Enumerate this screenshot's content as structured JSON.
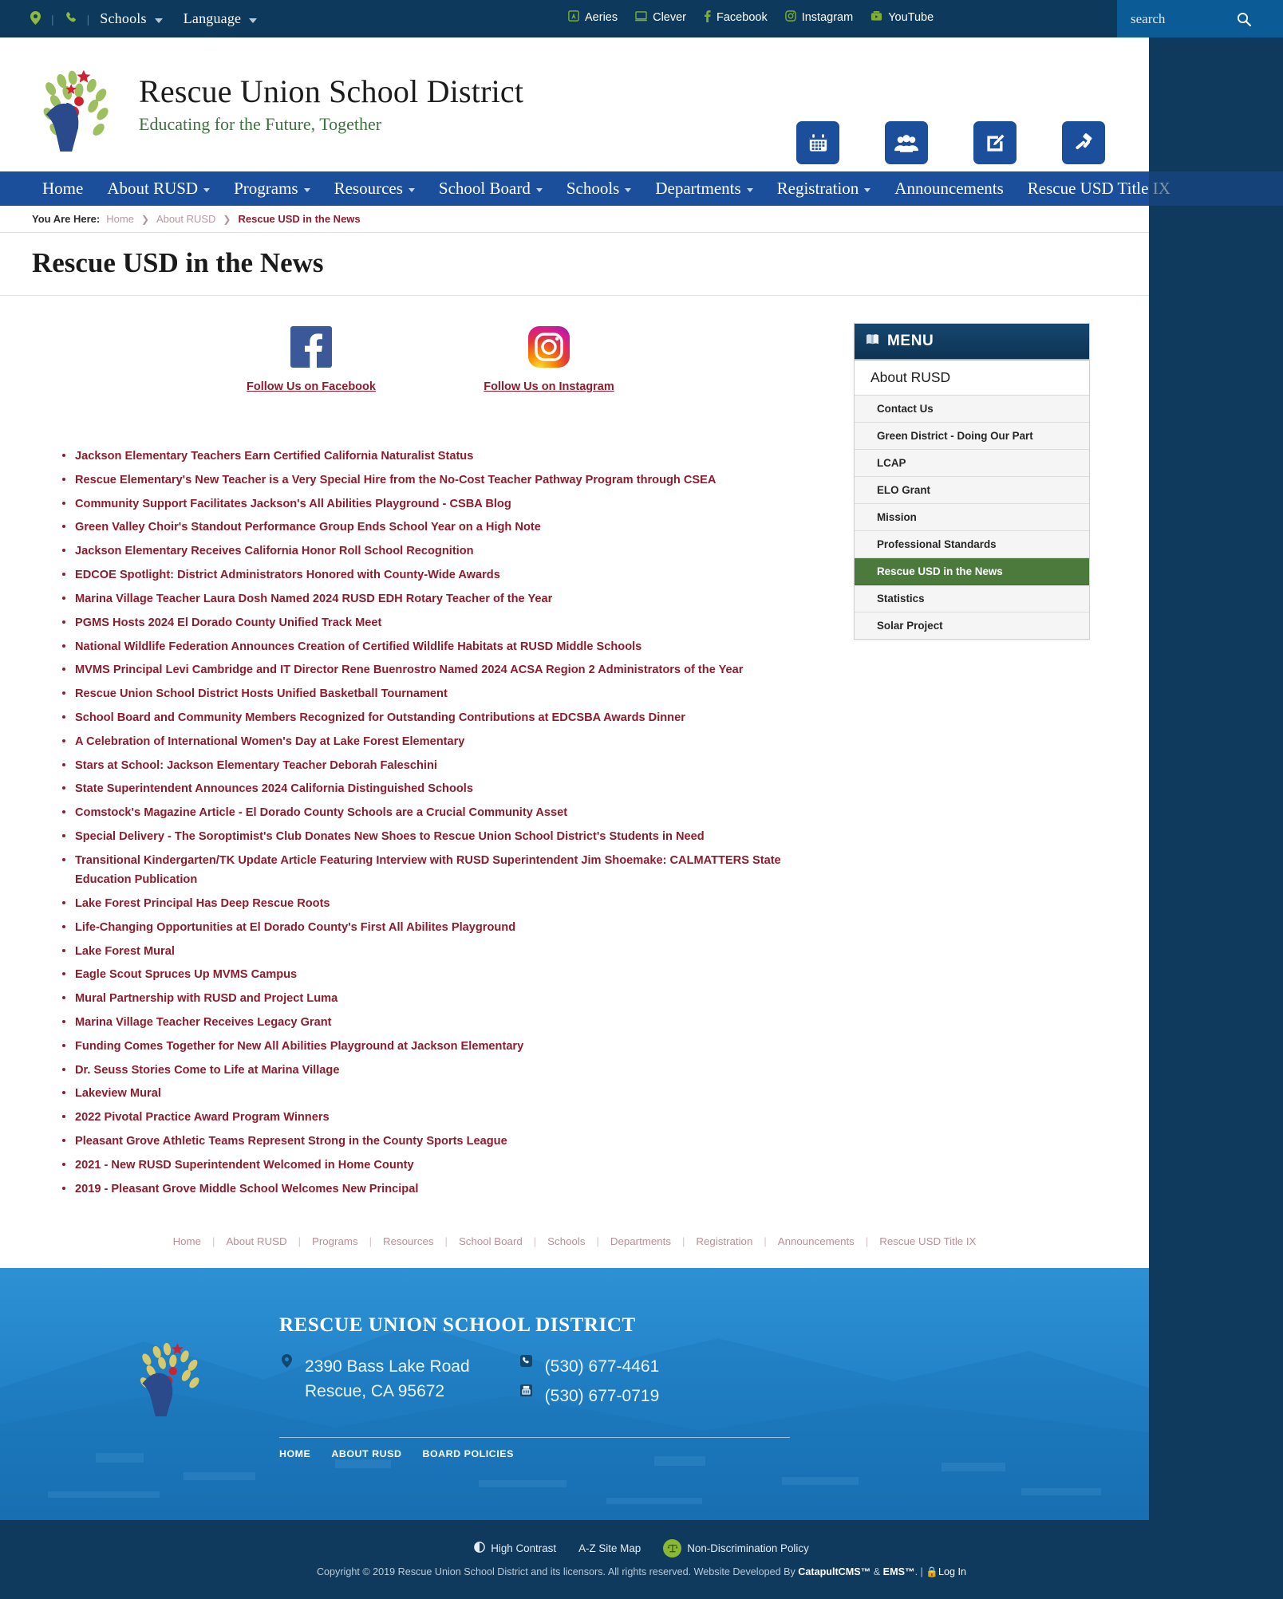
{
  "utility": {
    "location_icon": "map-pin-icon",
    "phone_icon": "phone-icon",
    "schools_label": "Schools",
    "language_label": "Language",
    "socials": [
      {
        "icon": "aeries-icon",
        "label": "Aeries"
      },
      {
        "icon": "clever-icon",
        "label": "Clever"
      },
      {
        "icon": "facebook-icon",
        "label": "Facebook"
      },
      {
        "icon": "instagram-icon",
        "label": "Instagram"
      },
      {
        "icon": "youtube-icon",
        "label": "YouTube"
      }
    ],
    "search_placeholder": "search"
  },
  "masthead": {
    "title": "Rescue Union School District",
    "tagline": "Educating for the Future, Together",
    "quicklinks": [
      {
        "icon": "calendar-icon",
        "label": "Calendar"
      },
      {
        "icon": "staff-directory-icon",
        "label": "Staff Directory"
      },
      {
        "icon": "enroll-pencil-icon",
        "label": "Enroll"
      },
      {
        "icon": "gavel-icon",
        "label": "Board Agendas"
      }
    ]
  },
  "mainnav": [
    {
      "label": "Home",
      "has_caret": false
    },
    {
      "label": "About RUSD",
      "has_caret": true
    },
    {
      "label": "Programs",
      "has_caret": true
    },
    {
      "label": "Resources",
      "has_caret": true
    },
    {
      "label": "School Board",
      "has_caret": true
    },
    {
      "label": "Schools",
      "has_caret": true
    },
    {
      "label": "Departments",
      "has_caret": true
    },
    {
      "label": "Registration",
      "has_caret": true
    },
    {
      "label": "Announcements",
      "has_caret": false
    },
    {
      "label": "Rescue USD Title IX",
      "has_caret": false
    }
  ],
  "breadcrumb": {
    "label": "You Are Here:",
    "home": "Home",
    "parent": "About RUSD",
    "current": "Rescue USD in the News"
  },
  "page_title": "Rescue USD in the News",
  "follow": [
    {
      "icon": "facebook-square-icon",
      "label": "Follow Us on Facebook"
    },
    {
      "icon": "instagram-square-icon",
      "label": "Follow Us on Instagram"
    }
  ],
  "news": [
    "Jackson Elementary Teachers Earn Certified California Naturalist Status",
    "Rescue Elementary's New Teacher is a Very Special Hire from the No-Cost Teacher Pathway Program through CSEA",
    "Community Support Facilitates Jackson's All Abilities Playground - CSBA Blog",
    "Green Valley Choir's Standout Performance Group Ends School Year on a High Note",
    "Jackson Elementary Receives California Honor Roll School Recognition",
    "EDCOE Spotlight: District Administrators Honored with County-Wide Awards",
    "Marina Village Teacher Laura Dosh Named 2024 RUSD EDH Rotary Teacher of the Year",
    "PGMS Hosts 2024 El Dorado County Unified Track Meet",
    "National Wildlife Federation Announces Creation of Certified Wildlife Habitats at RUSD Middle Schools",
    "MVMS Principal Levi Cambridge and IT Director Rene Buenrostro Named 2024 ACSA Region 2 Administrators of the Year",
    "Rescue Union School District Hosts Unified Basketball Tournament",
    "School Board and Community Members Recognized for Outstanding Contributions at EDCSBA Awards Dinner",
    "A Celebration of International Women's Day at Lake Forest Elementary",
    "Stars at School: Jackson Elementary Teacher Deborah Faleschini",
    "State Superintendent Announces 2024 California Distinguished Schools",
    "Comstock's Magazine Article - El Dorado County Schools are a Crucial Community Asset",
    "Special Delivery - The Soroptimist's Club Donates New Shoes to Rescue Union School District's Students in Need",
    "Transitional Kindergarten/TK Update Article Featuring Interview with RUSD Superintendent Jim Shoemake: CALMATTERS State Education Publication",
    "Lake Forest Principal Has Deep Rescue Roots",
    "Life-Changing Opportunities at El Dorado County's First All Abilites Playground",
    "Lake Forest Mural",
    "Eagle Scout Spruces Up MVMS Campus",
    "Mural Partnership with RUSD and Project Luma",
    "Marina Village Teacher Receives Legacy Grant",
    "Funding Comes Together for New All Abilities Playground at Jackson Elementary",
    "Dr. Seuss Stories Come to Life at Marina Village",
    "Lakeview Mural",
    "2022 Pivotal Practice Award Program Winners",
    "Pleasant Grove Athletic Teams Represent Strong in the County Sports League",
    "2021 - New RUSD Superintendent Welcomed in Home County",
    "2019 - Pleasant Grove Middle School Welcomes New Principal"
  ],
  "sidebar": {
    "heading": "MENU",
    "heading_icon": "book-icon",
    "section": "About RUSD",
    "items": [
      {
        "label": "Contact Us",
        "active": false
      },
      {
        "label": "Green District - Doing Our Part",
        "active": false
      },
      {
        "label": "LCAP",
        "active": false
      },
      {
        "label": "ELO Grant",
        "active": false
      },
      {
        "label": "Mission",
        "active": false
      },
      {
        "label": "Professional Standards",
        "active": false
      },
      {
        "label": "Rescue USD in the News",
        "active": true
      },
      {
        "label": "Statistics",
        "active": false
      },
      {
        "label": "Solar Project",
        "active": false
      }
    ]
  },
  "footernav": [
    "Home",
    "About RUSD",
    "Programs",
    "Resources",
    "School Board",
    "Schools",
    "Departments",
    "Registration",
    "Announcements",
    "Rescue USD Title IX"
  ],
  "footer": {
    "title": "RESCUE UNION SCHOOL DISTRICT",
    "address_line1": "2390 Bass Lake Road",
    "address_line2": "Rescue, CA 95672",
    "phone": "(530) 677-4461",
    "fax": "(530) 677-0719",
    "address_icon": "map-pin-icon",
    "phone_icon": "phone-icon",
    "fax_icon": "fax-icon",
    "sublinks": [
      "HOME",
      "ABOUT RUSD",
      "BOARD POLICIES"
    ]
  },
  "bottom": {
    "links": [
      {
        "icon": "contrast-icon",
        "label": "High Contrast"
      },
      {
        "icon": "",
        "label": "A-Z Site Map"
      },
      {
        "icon": "scales-icon",
        "label": "Non-Discrimination Policy"
      }
    ],
    "copyright_pre": "Copyright © 2019 Rescue Union School District and its licensors. All rights reserved. Website Developed By ",
    "vendor1": "CatapultCMS™",
    "amp": " & ",
    "vendor2": "EMS™",
    "copyright_post": ". | ",
    "login": "Log In",
    "login_icon": "lock-icon"
  },
  "colors": {
    "navy": "#103a5d",
    "nav_blue": "#1b4e9b",
    "accent_green": "#8cbb3f",
    "link_maroon": "#8d1d2c",
    "active_green": "#4c7a3c"
  }
}
